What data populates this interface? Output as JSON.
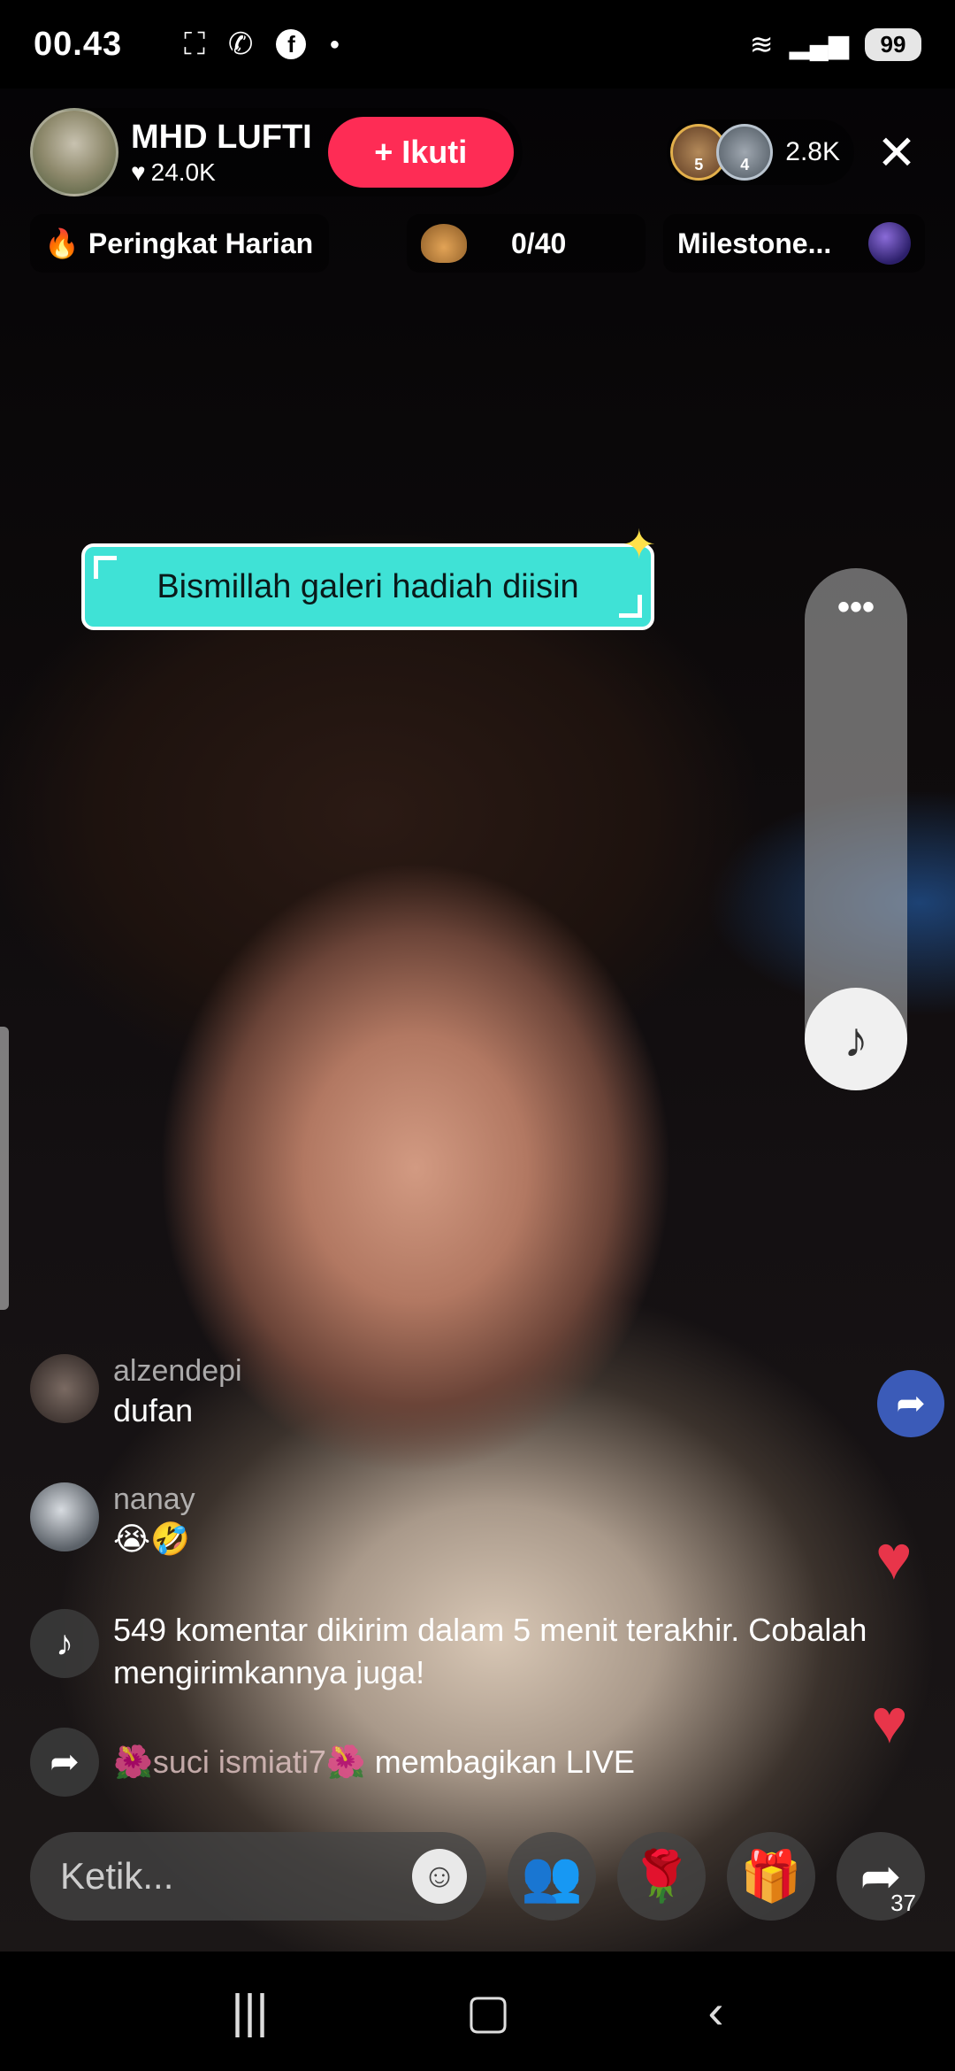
{
  "status_bar": {
    "time": "00.43",
    "icons_left": [
      "screenshot-icon",
      "missed-call-icon",
      "facebook-icon",
      "dot-icon"
    ],
    "icons_right": [
      "wifi-icon",
      "signal-icon"
    ],
    "battery": "99"
  },
  "host": {
    "name": "MHD LUFTI",
    "likes": "24.0K",
    "follow_label": "Ikuti"
  },
  "viewers": {
    "ranks": [
      "5",
      "4"
    ],
    "count": "2.8K"
  },
  "info_row": {
    "ranking_label": "Peringkat Harian",
    "goal_value": "0/40",
    "milestone_label": "Milestone..."
  },
  "pinned_message": "Bismillah galeri hadiah diisin",
  "comments": [
    {
      "user": "alzendepi",
      "text": "dufan"
    },
    {
      "user": "nanay",
      "text": "😭🤣"
    }
  ],
  "system_message": "549 komentar dikirim dalam 5 menit terakhir. Cobalah mengirimkannya juga!",
  "share_event": {
    "user": "🌺suci ismiati7🌺",
    "action": "membagikan LIVE"
  },
  "bottom_bar": {
    "input_placeholder": "Ketik...",
    "share_count": "37"
  },
  "colors": {
    "accent": "#fe2c55",
    "pinned_bg": "#3fe2d6",
    "heart": "#e8354a"
  }
}
